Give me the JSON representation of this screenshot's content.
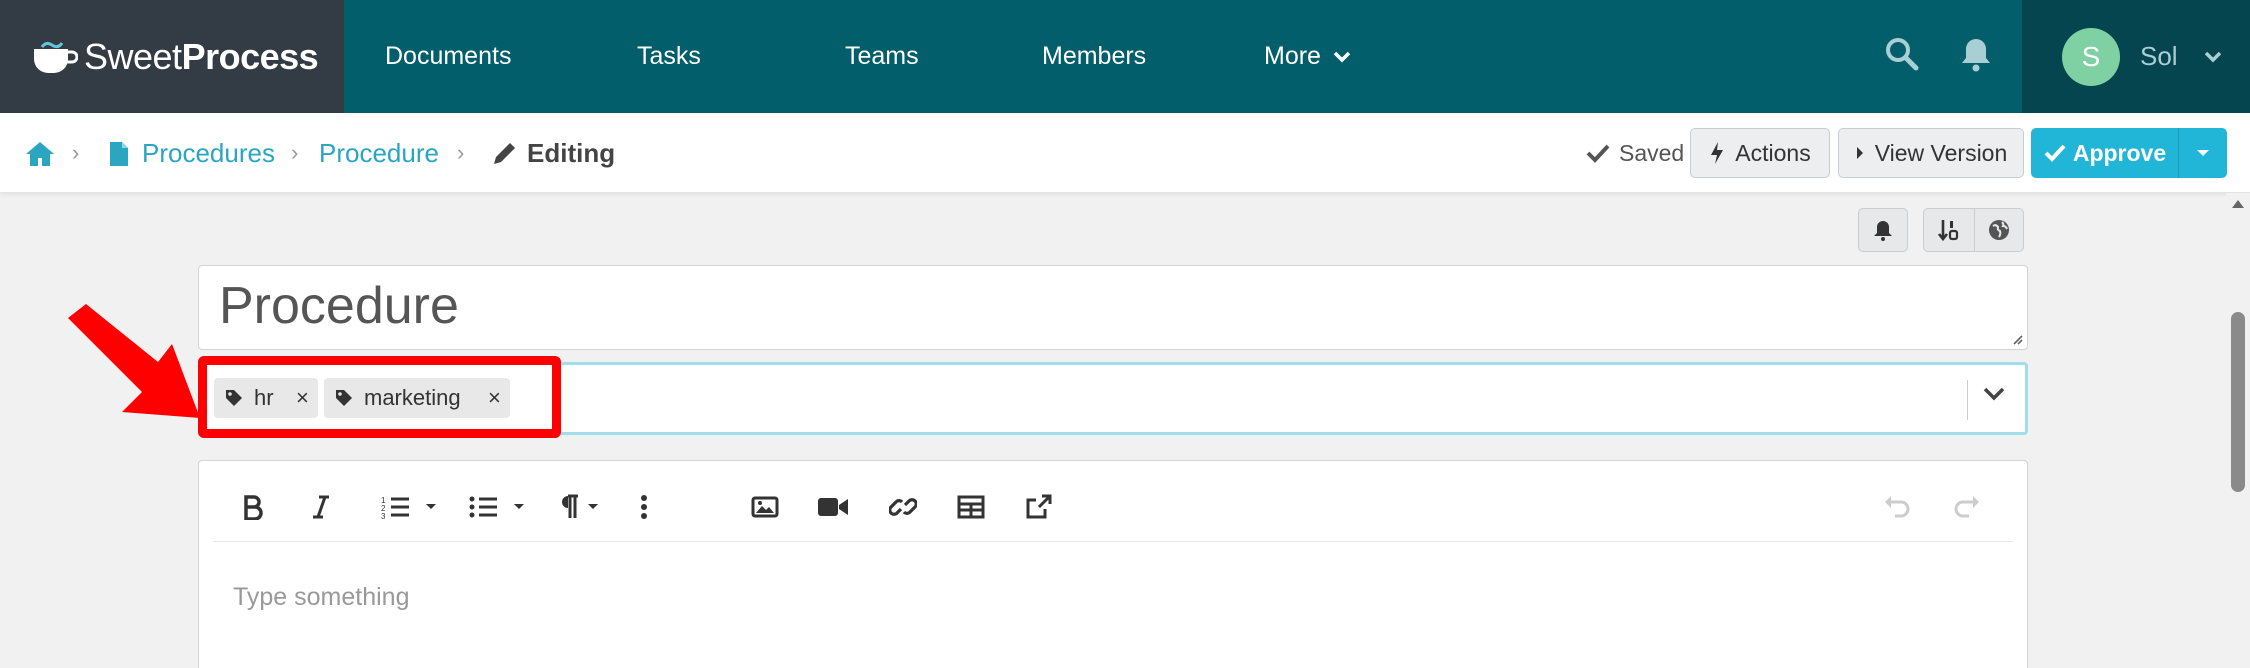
{
  "brand": {
    "word1": "Sweet",
    "word2": "Process"
  },
  "nav": {
    "items": [
      "Documents",
      "Tasks",
      "Teams",
      "Members",
      "More"
    ],
    "user": {
      "initial": "S",
      "name": "Sol"
    }
  },
  "breadcrumb": {
    "items": [
      "Procedures",
      "Procedure"
    ],
    "current": "Editing"
  },
  "toolbar": {
    "saved": "Saved",
    "actions": "Actions",
    "view_version": "View Version",
    "approve": "Approve"
  },
  "title_input": {
    "value": "Procedure"
  },
  "tags": [
    {
      "label": "hr",
      "remove": "×"
    },
    {
      "label": "marketing",
      "remove": "×"
    }
  ],
  "editor": {
    "placeholder": "Type something"
  },
  "colors": {
    "nav_bg": "#035e6b",
    "brand_bg": "#333b45",
    "user_bg": "#04454f",
    "link": "#2aa6c0",
    "approve": "#21b6d7",
    "highlight": "#ff0000",
    "tags_focus": "#9edfea"
  },
  "icons": [
    "coffee-cup-logo-icon",
    "search-icon",
    "bell-icon",
    "home-icon",
    "file-icon",
    "pencil-icon",
    "check-icon",
    "bolt-icon",
    "caret-right-icon",
    "sort-icon",
    "globe-icon",
    "tag-icon",
    "chevron-down-icon",
    "bold-icon",
    "italic-icon",
    "ordered-list-icon",
    "unordered-list-icon",
    "paragraph-icon",
    "more-vertical-icon",
    "image-icon",
    "video-icon",
    "link-icon",
    "table-icon",
    "external-link-icon",
    "undo-icon",
    "redo-icon",
    "red-arrow-annotation"
  ]
}
